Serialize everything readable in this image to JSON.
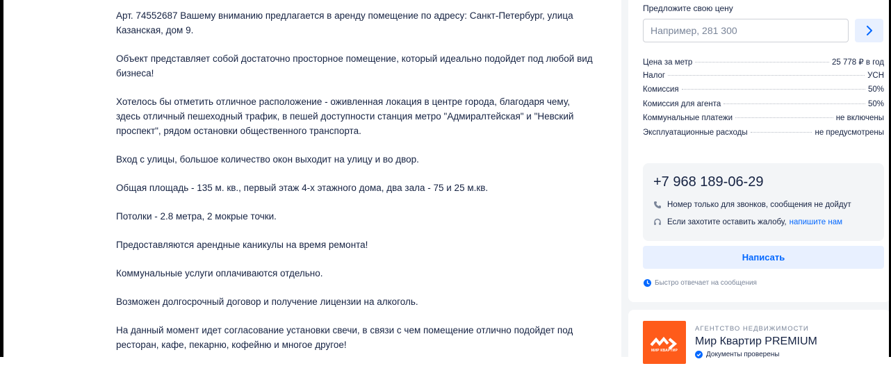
{
  "description": {
    "paragraphs": [
      "Арт. 74552687 Вашему вниманию предлагается в аренду помещение по адресу: Санкт-Петербург, улица Казанская, дом 9.",
      "Объект представляет собой достаточно просторное помещение, который идеально подойдет под любой вид бизнеса!",
      "Хотелось бы отметить отличное расположение - оживленная локация в центре города, благодаря чему, здесь отличный пешеходный трафик, в пешей доступности станция метро \"Адмиралтейская\" и \"Невский проспект\", рядом остановки общественного транспорта.",
      "Вход с улицы, большое количество окон выходит на улицу и во двор.",
      "Общая площадь - 135 м. кв., первый этаж 4-х этажного дома, два зала - 75 и 25 м.кв.",
      "Потолки - 2.8 метра, 2 мокрые точки.",
      "Предоставляются арендные каникулы на время ремонта!",
      "Коммунальные услуги оплачиваются отдельно.",
      "Возможен долгосрочный договор и получение лицензии на алкоголь.",
      "На данный момент идет согласование установки свечи, в связи с чем помещение отлично подойдет под ресторан, кафе, пекарню, кофейню и многое другое!"
    ]
  },
  "offer": {
    "label": "Предложите свою цену",
    "placeholder": "Например, 281 300"
  },
  "terms": [
    {
      "label": "Цена за метр",
      "value": "25 778 ₽ в год"
    },
    {
      "label": "Налог",
      "value": "УСН"
    },
    {
      "label": "Комиссия",
      "value": "50%"
    },
    {
      "label": "Комиссия для агента",
      "value": "50%"
    },
    {
      "label": "Коммунальные платежи",
      "value": "не включены"
    },
    {
      "label": "Эксплуатационные расходы",
      "value": "не предусмотрены"
    }
  ],
  "contact": {
    "phone": "+7 968 189-06-29",
    "calls_only_note": "Номер только для звонков, сообщения не дойдут",
    "complaint_note": "Если захотите оставить жалобу,",
    "complaint_link": "напишите нам",
    "write_button": "Написать",
    "fast_reply": "Быстро отвечает на сообщения"
  },
  "agency": {
    "type": "АГЕНТСТВО НЕДВИЖИМОСТИ",
    "name": "Мир Квартир PREMIUM",
    "docs_status": "Документы проверены",
    "logo_text": "МИР КВАРТИР"
  },
  "colors": {
    "accent": "#0468ff",
    "accent_light": "#e8f0ff",
    "logo_orange": "#ff5b1a",
    "text": "#152242",
    "muted": "#7a8599"
  }
}
